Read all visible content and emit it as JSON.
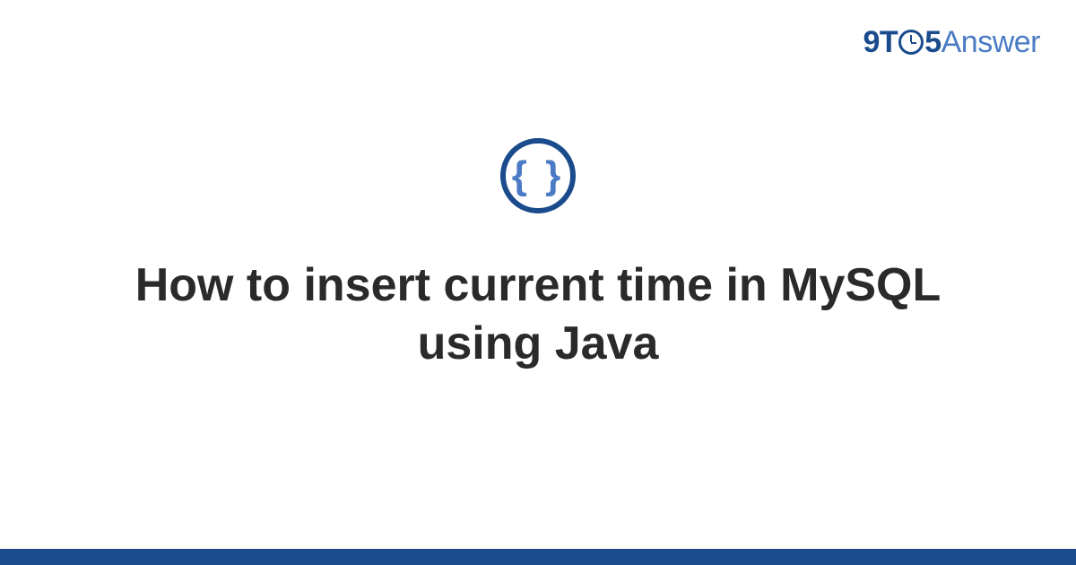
{
  "logo": {
    "part1": "9",
    "part2": "T",
    "part3": "5",
    "part4": "Answer"
  },
  "category_icon": {
    "symbol": "{ }",
    "name": "code-braces-icon"
  },
  "title": "How to insert current time in MySQL using Java",
  "colors": {
    "primary": "#1a4b8c",
    "secondary": "#4a7bc4",
    "text": "#2a2a2a"
  }
}
